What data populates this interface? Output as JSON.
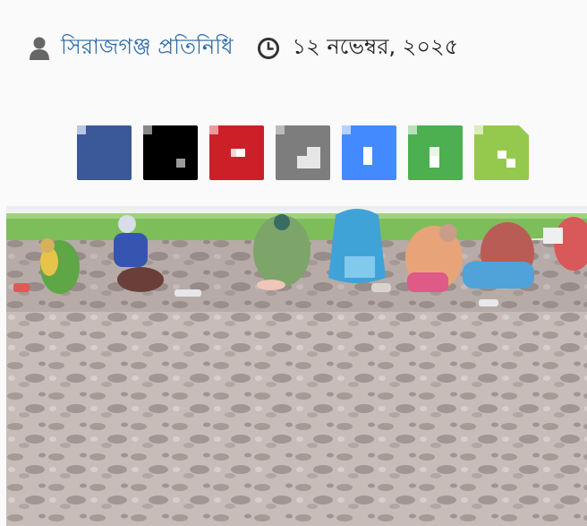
{
  "article_meta": {
    "author_icon": "user-icon",
    "author": "সিরাজগঞ্জ প্রতিনিধি",
    "date_icon": "clock-icon",
    "date": "১২ নভেম্বর, ২০২৫"
  },
  "share_buttons": [
    {
      "name": "facebook-share-button",
      "color": "#3b5998",
      "icon": "facebook-icon"
    },
    {
      "name": "x-share-button",
      "color": "#000000",
      "icon": "x-icon"
    },
    {
      "name": "pinterest-share-button",
      "color": "#cb2027",
      "icon": "pinterest-icon"
    },
    {
      "name": "email-share-button",
      "color": "#7d7d7d",
      "icon": "email-icon"
    },
    {
      "name": "messenger-share-button",
      "color": "#448aff",
      "icon": "messenger-icon"
    },
    {
      "name": "whatsapp-share-button",
      "color": "#4caf50",
      "icon": "whatsapp-icon"
    },
    {
      "name": "share-button",
      "color": "#95c94e",
      "icon": "share-icon"
    }
  ],
  "photo": {
    "subject": "field-workers-photo"
  }
}
